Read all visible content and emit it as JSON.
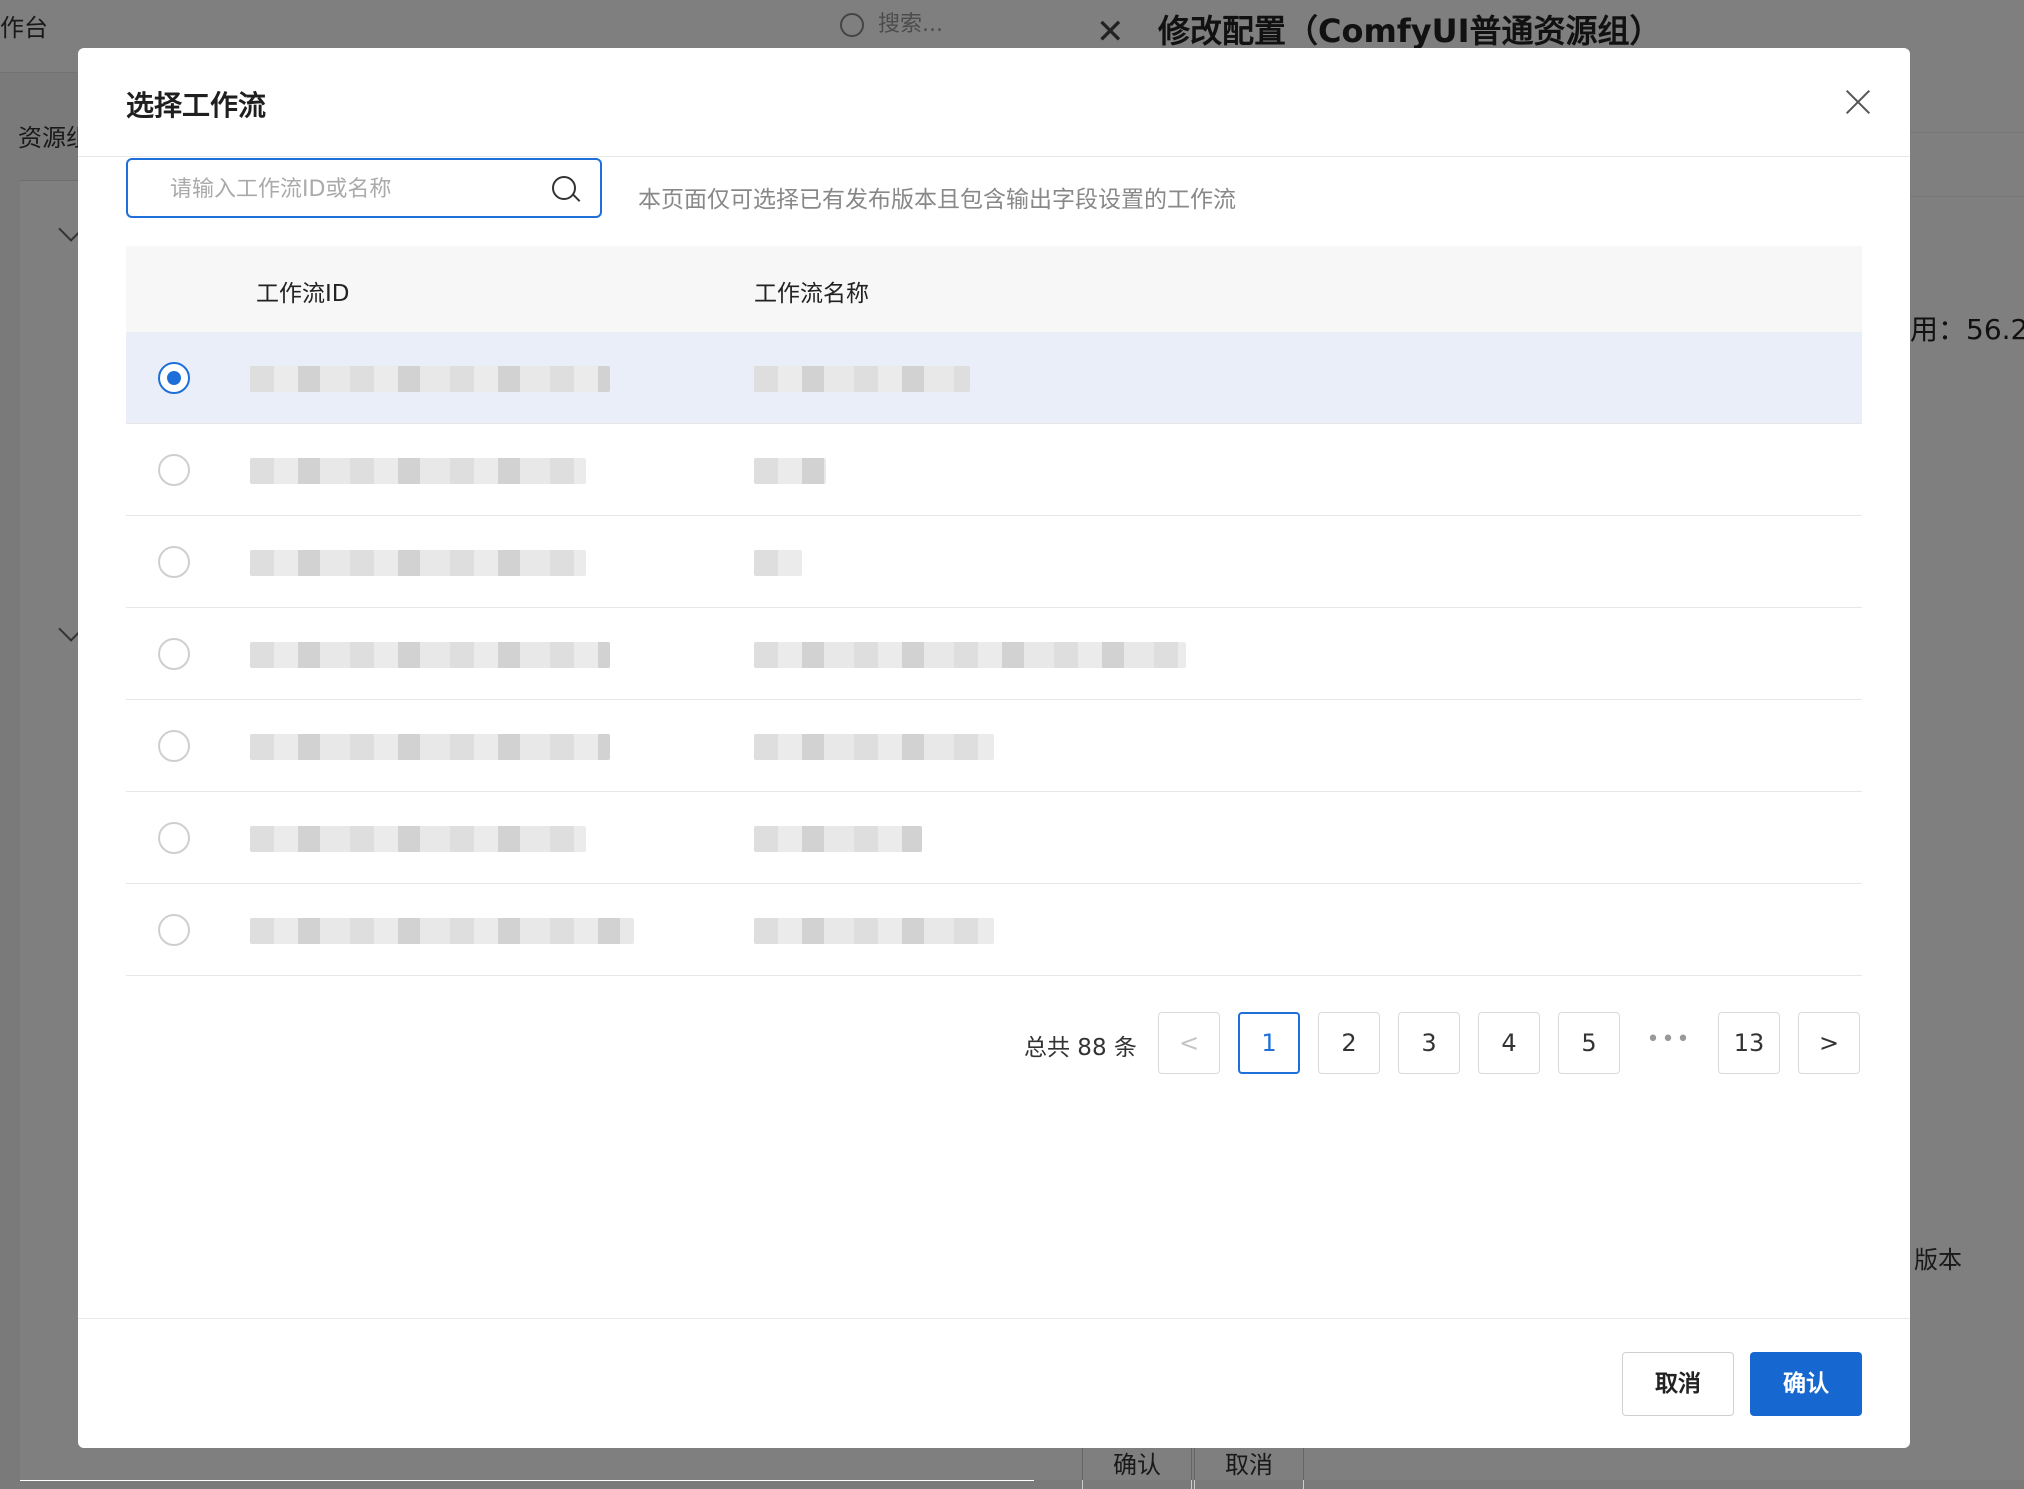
{
  "background": {
    "breadcrumb": "作台",
    "search_placeholder": "搜索...",
    "resource_label": "资源组",
    "drawer_title": "修改配置（ComfyUI普通资源组）",
    "usage_text": "用：56.2",
    "version_label": "版本",
    "footer_confirm": "确认",
    "footer_cancel": "取消"
  },
  "modal": {
    "title": "选择工作流",
    "search": {
      "placeholder": "请输入工作流ID或名称",
      "value": ""
    },
    "hint": "本页面仅可选择已有发布版本且包含输出字段设置的工作流",
    "table": {
      "columns": [
        "工作流ID",
        "工作流名称"
      ],
      "rows": [
        {
          "selected": true
        },
        {
          "selected": false
        },
        {
          "selected": false
        },
        {
          "selected": false
        },
        {
          "selected": false
        },
        {
          "selected": false
        },
        {
          "selected": false
        }
      ]
    },
    "pagination": {
      "total_text": "总共 88 条",
      "prev": "<",
      "next": ">",
      "pages": [
        "1",
        "2",
        "3",
        "4",
        "5"
      ],
      "ellipsis": "•••",
      "last_page": "13",
      "current": "1"
    },
    "buttons": {
      "cancel": "取消",
      "confirm": "确认"
    }
  },
  "colors": {
    "primary": "#1668d0",
    "selected_row": "#e9eef9"
  },
  "icons": [
    "close-icon",
    "search-icon",
    "chevron-left-icon",
    "chevron-right-icon"
  ]
}
